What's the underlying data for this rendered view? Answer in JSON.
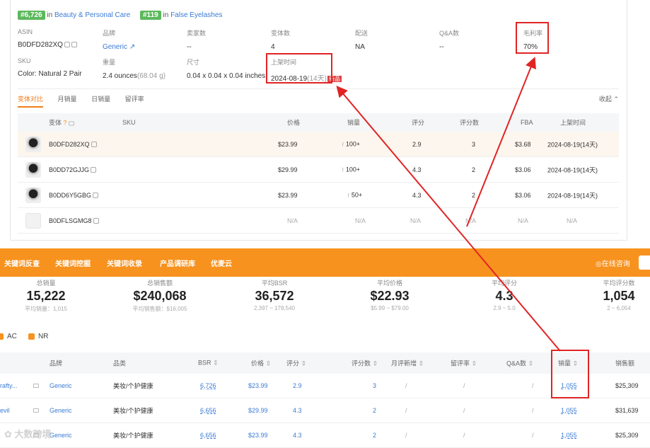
{
  "ranks": [
    {
      "badge": "#6,726",
      "in": "in",
      "category": "Beauty & Personal Care"
    },
    {
      "badge": "#119",
      "in": "in",
      "category": "False Eyelashes"
    }
  ],
  "info_row1": [
    {
      "label": "ASIN",
      "value": "B0DFD282XQ"
    },
    {
      "label": "品牌",
      "value": "Generic"
    },
    {
      "label": "卖家数",
      "value": "--"
    },
    {
      "label": "变体数",
      "value": "4"
    },
    {
      "label": "配送",
      "value": "NA"
    },
    {
      "label": "Q&A数",
      "value": "--"
    },
    {
      "label": "毛利率",
      "value": "70%"
    }
  ],
  "info_row2": [
    {
      "label": "SKU",
      "value": "Color: Natural 2 Pair"
    },
    {
      "label": "重量",
      "value": "2.4 ounces",
      "value2": "(68.04 g)"
    },
    {
      "label": "尺寸",
      "value": "0.04 x 0.04 x 0.04 inches"
    },
    {
      "label": "上架时间",
      "value": "2024-08-19",
      "value2": "(14天)",
      "badge": "新品"
    }
  ],
  "tabs": [
    "变体对比",
    "月销量",
    "日销量",
    "留评率"
  ],
  "collapse": "收起",
  "variant_table": {
    "headers": [
      "变体",
      "SKU",
      "价格",
      "销量",
      "评分",
      "评分数",
      "FBA",
      "上架时间"
    ],
    "rows": [
      {
        "asin": "B0DFD282XQ",
        "price": "$23.99",
        "sales": "100+",
        "rating": "2.9",
        "reviews": "3",
        "fba": "$3.68",
        "date": "2024-08-19(14天)"
      },
      {
        "asin": "B0DD72GJJG",
        "price": "$29.99",
        "sales": "100+",
        "rating": "4.3",
        "reviews": "2",
        "fba": "$3.06",
        "date": "2024-08-19(14天)"
      },
      {
        "asin": "B0DD6Y5GBG",
        "price": "$23.99",
        "sales": "50+",
        "rating": "4.3",
        "reviews": "2",
        "fba": "$3.06",
        "date": "2024-08-19(14天)"
      },
      {
        "asin": "B0DFLSGMG8",
        "price": "N/A",
        "sales": "N/A",
        "rating": "N/A",
        "reviews": "N/A",
        "fba": "N/A",
        "date": "N/A"
      }
    ]
  },
  "toolbar": {
    "items": [
      "关键词反查",
      "关键词挖掘",
      "关键词收录",
      "产品调研库",
      "优麦云"
    ],
    "right": "在线咨询"
  },
  "stats": [
    {
      "title": "总销量",
      "value": "15,222",
      "sub": "平均销量：1,015"
    },
    {
      "title": "总销售额",
      "value": "$240,068",
      "sub": "平均销售额：$16,005"
    },
    {
      "title": "平均BSR",
      "value": "36,572",
      "sub": "2,397 ~ 178,540"
    },
    {
      "title": "平均价格",
      "value": "$22.93",
      "sub": "$5.99 ~ $79.00"
    },
    {
      "title": "平均评分",
      "value": "4.3",
      "sub": "2.9 ~ 5.0"
    },
    {
      "title": "平均评分数",
      "value": "1,054",
      "sub": "2 ~ 6,054"
    }
  ],
  "legend": [
    "AC",
    "NR"
  ],
  "product_table": {
    "headers": [
      "品牌",
      "品类",
      "BSR",
      "价格",
      "评分",
      "评分数",
      "月评新增",
      "留评率",
      "Q&A数",
      "销量",
      "销售额"
    ],
    "rows": [
      {
        "name": "rafty...",
        "brand": "Generic",
        "category": "美妆/个护健康",
        "bsr": "6,726",
        "price": "$23.99",
        "rating": "2.9",
        "reviews": "3",
        "new": "/",
        "rate": "/",
        "qa": "/",
        "sales": "1,055",
        "revenue": "$25,309"
      },
      {
        "name": "evil",
        "brand": "Generic",
        "category": "美妆/个护健康",
        "bsr": "6,656",
        "price": "$29.99",
        "rating": "4.3",
        "reviews": "2",
        "new": "/",
        "rate": "/",
        "qa": "/",
        "sales": "1,055",
        "revenue": "$31,639"
      },
      {
        "name": "",
        "brand": "Generic",
        "category": "美妆/个护健康",
        "bsr": "6,656",
        "price": "$23.99",
        "rating": "4.3",
        "reviews": "2",
        "new": "/",
        "rate": "/",
        "qa": "/",
        "sales": "1,055",
        "revenue": "$25,309"
      }
    ]
  },
  "watermark": "大数跨境",
  "colors": {
    "accent": "#f7921e",
    "link": "#3a7bd5",
    "highlight": "#e02424",
    "rank_badge": "#5cb85c"
  }
}
